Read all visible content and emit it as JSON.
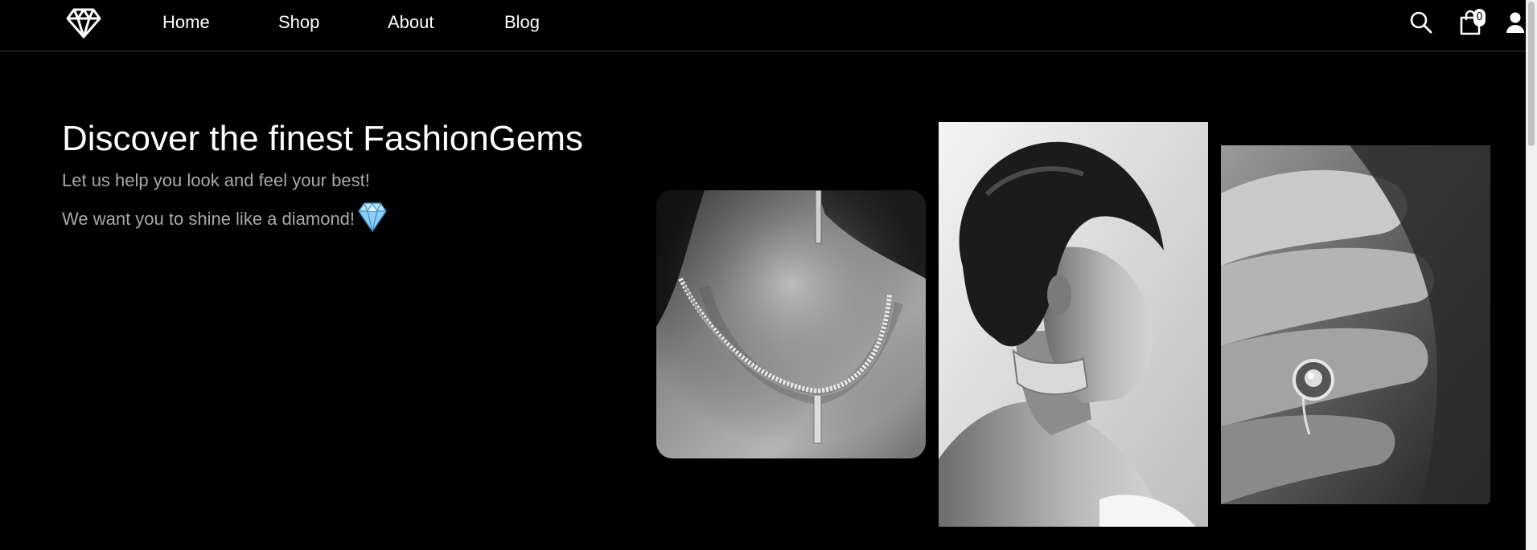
{
  "nav": {
    "logo_icon": "diamond-icon",
    "links": [
      {
        "label": "Home"
      },
      {
        "label": "Shop"
      },
      {
        "label": "About"
      },
      {
        "label": "Blog"
      }
    ],
    "search_icon": "search-icon",
    "cart_icon": "shopping-bag-icon",
    "cart_count": "0",
    "account_icon": "user-icon"
  },
  "hero": {
    "title": "Discover the finest FashionGems",
    "subtitle_1": "Let us help you look and feel your best!",
    "subtitle_2": "We want you to shine like a diamond!",
    "subtitle_icon": "gem-emoji-icon"
  },
  "gallery": [
    {
      "icon": "necklace-photo"
    },
    {
      "icon": "woman-portrait-photo"
    },
    {
      "icon": "ring-hand-photo"
    }
  ],
  "colors": {
    "background": "#000000",
    "text": "#ffffff",
    "muted_text": "#a9a9a9",
    "gem_blue": "#8ecdf5"
  }
}
